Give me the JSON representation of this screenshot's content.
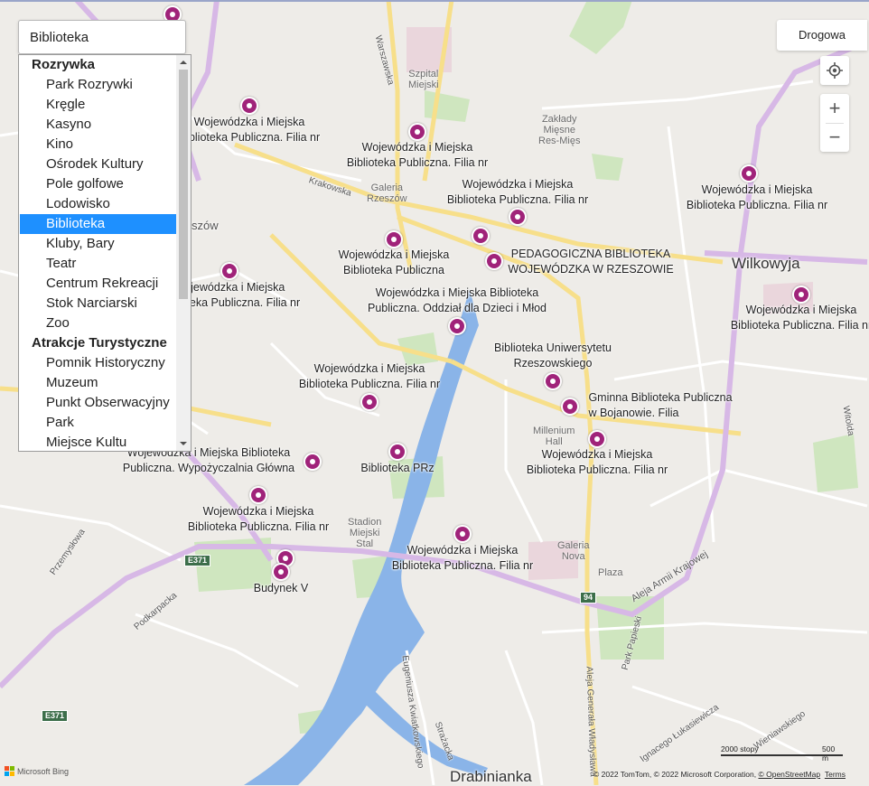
{
  "search": {
    "value": "Biblioteka"
  },
  "category_list": {
    "groups": [
      {
        "title": "Rozrywka",
        "items": [
          "Park Rozrywki",
          "Kręgle",
          "Kasyno",
          "Kino",
          "Ośrodek Kultury",
          "Pole golfowe",
          "Lodowisko",
          "Biblioteka",
          "Kluby, Bary",
          "Teatr",
          "Centrum Rekreacji",
          "Stok Narciarski",
          "Zoo"
        ]
      },
      {
        "title": "Atrakcje Turystyczne",
        "items": [
          "Pomnik Historyczny",
          "Muzeum",
          "Punkt Obserwacyjny",
          "Park",
          "Miejsce Kultu"
        ]
      }
    ],
    "selected": "Biblioteka"
  },
  "controls": {
    "map_style": "Drogowa",
    "zoom_in": "+",
    "zoom_out": "−",
    "locate_icon": "crosshair-icon"
  },
  "pois": [
    {
      "label": "Wojewódzka i Miejska\nBiblioteka Publiczna. Filia nr"
    },
    {
      "label": "Wojewódzka i Miejska\nBiblioteka Publiczna. Filia nr"
    },
    {
      "label": "Wojewódzka i Miejska\nBiblioteka Publiczna. Filia nr"
    },
    {
      "label": "Wojewódzka i Miejska\nBiblioteka Publiczna. Filia nr"
    },
    {
      "label": "Wojewódzka i Miejska\nBiblioteka Publiczna"
    },
    {
      "label": "PEDAGOGICZNA BIBLIOTEKA\nWOJEWÓDZKA W RZESZOWIE"
    },
    {
      "label": ""
    },
    {
      "label": ""
    },
    {
      "label": "Wojewódzka i Miejska\nBiblioteka Publiczna. Filia nr"
    },
    {
      "label": "Wojewódzka i Miejska\nBiblioteka Publiczna. Filia nr"
    },
    {
      "label": "Wojewódzka i Miejska Biblioteka\nPubliczna. Oddział dla Dzieci i Młod"
    },
    {
      "label": "Wojewódzka i Miejska\nBiblioteka Publiczna. Filia nr"
    },
    {
      "label": "Biblioteka Uniwersytetu\nRzeszowskiego"
    },
    {
      "label": "Gminna Biblioteka Publiczna\nw Bojanowie. Filia"
    },
    {
      "label": "Wojewódzka i Miejska\nBiblioteka Publiczna. Filia nr"
    },
    {
      "label": "Biblioteka PRz"
    },
    {
      "label": "Wojewódzka i Miejska Biblioteka\nPubliczna. Wypożyczalnia Główna"
    },
    {
      "label": "Wojewódzka i Miejska\nBiblioteka Publiczna. Filia nr"
    },
    {
      "label": "Wojewódzka i Miejska\nBiblioteka Publiczna. Filia nr"
    },
    {
      "label": "Budynek V"
    },
    {
      "label": ""
    }
  ],
  "map_labels": {
    "districts": [
      "Wilkowyja",
      "Drabinianka",
      "szów"
    ],
    "places": [
      "Szpital\nMiejski",
      "Zakłady\nMięsne\nRes-Mięs",
      "Galeria\nRzeszów",
      "Millenium\nHall",
      "Stadion\nMiejski\nStal",
      "Galeria\nNova",
      "Plaza"
    ],
    "streets": [
      "Warszawska",
      "Krakowska",
      "Podkarpacka",
      "Przemysłowa",
      "Aleja Armii Krajowej",
      "Aleja Generała Władysława",
      "Eugeniusza Kwiatkowskiego",
      "Strażacka",
      "Park Papieski",
      "Ignacego Łukasiewicza",
      "Witolda",
      "Wieniawskiego"
    ],
    "shields": [
      "E371",
      "E371",
      "94"
    ]
  },
  "footer": {
    "brand": "Microsoft Bing",
    "copyright": "© 2022 TomTom, © 2022 Microsoft Corporation, ",
    "osm": "© OpenStreetMap",
    "terms": "Terms",
    "scale_ft": "2000 stopy",
    "scale_m": "500 m"
  },
  "colors": {
    "poi": "#a0237a",
    "selected": "#1e90ff",
    "highway": "#d7b8e6",
    "main_road": "#f7df8a",
    "river": "#8ab4e8",
    "green": "#cfe6bf"
  }
}
